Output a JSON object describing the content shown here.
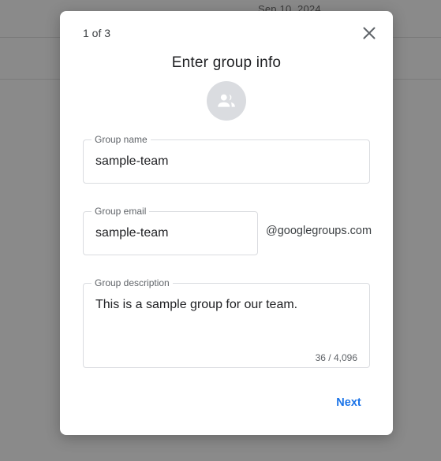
{
  "background": {
    "date_text": "Sep 10, 2024"
  },
  "dialog": {
    "step_indicator": "1 of 3",
    "title": "Enter group info",
    "close_icon": "close-icon",
    "avatar_icon": "group-icon",
    "fields": {
      "group_name": {
        "label": "Group name",
        "value": "sample-team"
      },
      "group_email": {
        "label": "Group email",
        "value": "sample-team",
        "suffix": "@googlegroups.com"
      },
      "group_description": {
        "label": "Group description",
        "value": "This is a sample group for our team.",
        "counter": "36 / 4,096"
      }
    },
    "next_label": "Next"
  },
  "colors": {
    "accent": "#1a73e8",
    "backdrop": "#8a8a8a",
    "border": "#dadce0",
    "avatar_bg": "#dadce0"
  }
}
